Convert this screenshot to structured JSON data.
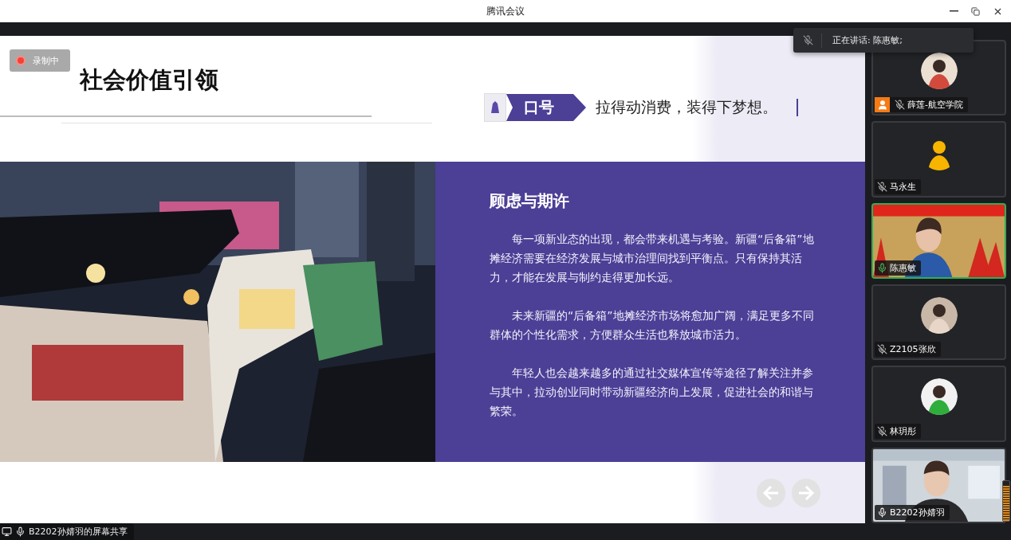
{
  "window": {
    "title": "腾讯会议"
  },
  "recording": {
    "label": "录制中",
    "on": true
  },
  "speaking_toast": {
    "label": "正在讲话: 陈惠敏;"
  },
  "slide": {
    "title": "社会价值引领",
    "slogan_tag": "口号",
    "slogan": "拉得动消费，装得下梦想。",
    "panel": {
      "heading": "顾虑与期许",
      "paragraphs": [
        "每一项新业态的出现，都会带来机遇与考验。新疆“后备箱”地摊经济需要在经济发展与城市治理间找到平衡点。只有保持其活力，才能在发展与制约走得更加长远。",
        "未来新疆的“后备箱”地摊经济市场将愈加广阔，满足更多不同群体的个性化需求，方便群众生活也释放城市活力。",
        "年轻人也会越来越多的通过社交媒体宣传等途径了解关注并参与其中，拉动创业同时带动新疆经济向上发展，促进社会的和谐与繁荣。"
      ]
    }
  },
  "participants": [
    {
      "name": "薛莲-航空学院",
      "muted": true,
      "kind": "avatar",
      "host": true,
      "speaking": false
    },
    {
      "name": "马永生",
      "muted": true,
      "kind": "avatar",
      "host": false,
      "speaking": false
    },
    {
      "name": "陈惠敏",
      "muted": false,
      "kind": "video",
      "host": false,
      "speaking": true
    },
    {
      "name": "Z2105张欣",
      "muted": true,
      "kind": "avatar",
      "host": false,
      "speaking": false
    },
    {
      "name": "林玥彤",
      "muted": true,
      "kind": "avatar",
      "host": false,
      "speaking": false
    },
    {
      "name": "B2202孙婧羽",
      "muted": false,
      "kind": "video",
      "host": false,
      "speaking": false
    }
  ],
  "volume_meter": {
    "level": 0.9
  },
  "share_bar": {
    "label": "B2202孙婧羽的屏幕共享"
  }
}
